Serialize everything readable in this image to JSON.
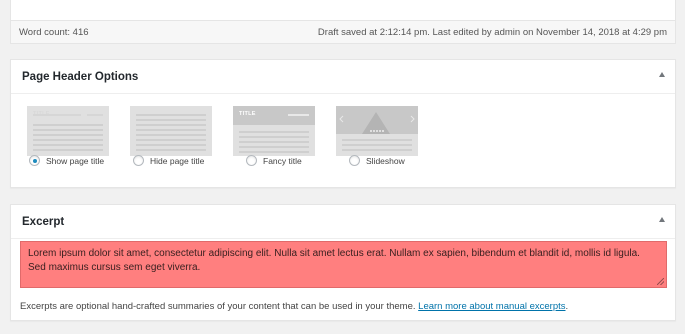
{
  "status": {
    "word_count": "Word count: 416",
    "draft_saved": "Draft saved at 2:12:14 pm. Last edited by admin on November 14, 2018 at 4:29 pm"
  },
  "page_header_options": {
    "title": "Page Header Options",
    "options": [
      {
        "label": "Show page title",
        "checked": true,
        "thumb_text": "TITLE"
      },
      {
        "label": "Hide page title",
        "checked": false,
        "thumb_text": ""
      },
      {
        "label": "Fancy title",
        "checked": false,
        "thumb_text": "TITLE"
      },
      {
        "label": "Slideshow",
        "checked": false,
        "thumb_text": ""
      }
    ]
  },
  "excerpt": {
    "title": "Excerpt",
    "text": "Lorem ipsum dolor sit amet, consectetur adipiscing elit. Nulla sit amet lectus erat. Nullam ex sapien, bibendum et blandit id, mollis id ligula. Sed maximus cursus sem eget viverra.",
    "help_text": "Excerpts are optional hand-crafted summaries of your content that can be used in your theme.",
    "help_link": "Learn more about manual excerpts",
    "help_suffix": ".",
    "highlight_color": "#ff7f7f",
    "link_color": "#0073aa"
  },
  "icons": {
    "toggle": "arrow-up-icon",
    "radio": "radio-icon"
  }
}
